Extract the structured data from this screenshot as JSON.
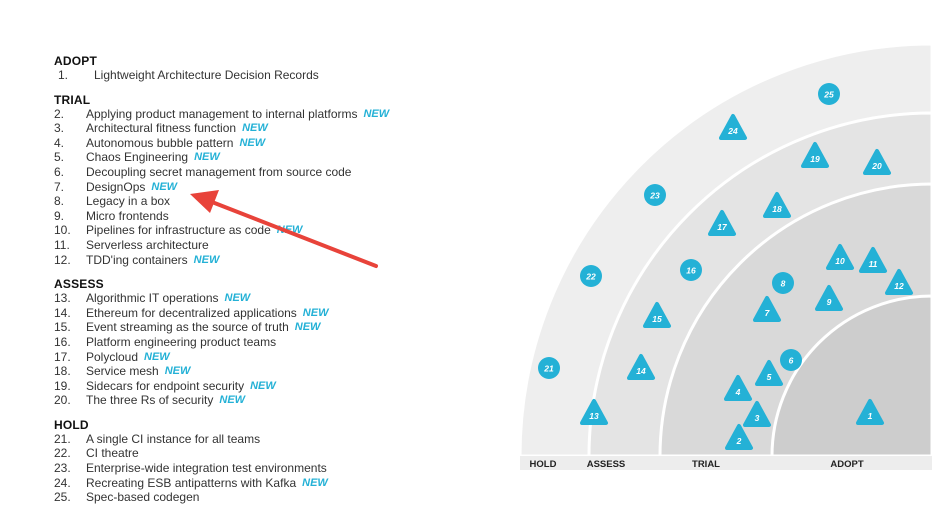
{
  "rings": [
    {
      "name": "ADOPT",
      "entries": [
        {
          "num": "1.",
          "label": "Lightweight Architecture Decision Records",
          "new": false
        }
      ]
    },
    {
      "name": "TRIAL",
      "entries": [
        {
          "num": "2.",
          "label": "Applying product management to internal platforms",
          "new": true
        },
        {
          "num": "3.",
          "label": "Architectural fitness function",
          "new": true
        },
        {
          "num": "4.",
          "label": "Autonomous bubble pattern",
          "new": true
        },
        {
          "num": "5.",
          "label": "Chaos Engineering",
          "new": true
        },
        {
          "num": "6.",
          "label": "Decoupling secret management from source code",
          "new": false
        },
        {
          "num": "7.",
          "label": "DesignOps",
          "new": true
        },
        {
          "num": "8.",
          "label": "Legacy in a box",
          "new": false
        },
        {
          "num": "9.",
          "label": "Micro frontends",
          "new": false
        },
        {
          "num": "10.",
          "label": "Pipelines for infrastructure as code",
          "new": true
        },
        {
          "num": "11.",
          "label": "Serverless architecture",
          "new": false
        },
        {
          "num": "12.",
          "label": "TDD'ing containers",
          "new": true
        }
      ]
    },
    {
      "name": "ASSESS",
      "entries": [
        {
          "num": "13.",
          "label": "Algorithmic IT operations",
          "new": true
        },
        {
          "num": "14.",
          "label": "Ethereum for decentralized applications",
          "new": true
        },
        {
          "num": "15.",
          "label": "Event streaming as the source of truth",
          "new": true
        },
        {
          "num": "16.",
          "label": "Platform engineering product teams",
          "new": false
        },
        {
          "num": "17.",
          "label": "Polycloud",
          "new": true
        },
        {
          "num": "18.",
          "label": "Service mesh",
          "new": true
        },
        {
          "num": "19.",
          "label": "Sidecars for endpoint security",
          "new": true
        },
        {
          "num": "20.",
          "label": "The three Rs of security",
          "new": true
        }
      ]
    },
    {
      "name": "HOLD",
      "entries": [
        {
          "num": "21.",
          "label": "A single CI instance for all teams",
          "new": false
        },
        {
          "num": "22.",
          "label": "CI theatre",
          "new": false
        },
        {
          "num": "23.",
          "label": "Enterprise-wide integration test environments",
          "new": false
        },
        {
          "num": "24.",
          "label": "Recreating ESB antipatterns with Kafka",
          "new": true
        },
        {
          "num": "25.",
          "label": "Spec-based codegen",
          "new": false
        }
      ]
    }
  ],
  "new_tag": "NEW",
  "radar": {
    "ring_labels": [
      "HOLD",
      "ASSESS",
      "TRIAL",
      "ADOPT"
    ],
    "colors": {
      "blip": "#24b1d6",
      "ring_hold": "#eeeeee",
      "ring_assess": "#e4e4e4",
      "ring_trial": "#d9d9d9",
      "ring_adopt": "#cdcdcd",
      "arrow": "#e8433a",
      "new_text": "#24b1d6"
    },
    "blips": [
      {
        "id": "1",
        "shape": "triangle"
      },
      {
        "id": "2",
        "shape": "triangle"
      },
      {
        "id": "3",
        "shape": "triangle"
      },
      {
        "id": "4",
        "shape": "triangle"
      },
      {
        "id": "5",
        "shape": "triangle"
      },
      {
        "id": "6",
        "shape": "circle"
      },
      {
        "id": "7",
        "shape": "triangle"
      },
      {
        "id": "8",
        "shape": "circle"
      },
      {
        "id": "9",
        "shape": "triangle"
      },
      {
        "id": "10",
        "shape": "triangle"
      },
      {
        "id": "11",
        "shape": "triangle"
      },
      {
        "id": "12",
        "shape": "triangle"
      },
      {
        "id": "13",
        "shape": "triangle"
      },
      {
        "id": "14",
        "shape": "triangle"
      },
      {
        "id": "15",
        "shape": "triangle"
      },
      {
        "id": "16",
        "shape": "circle"
      },
      {
        "id": "17",
        "shape": "triangle"
      },
      {
        "id": "18",
        "shape": "triangle"
      },
      {
        "id": "19",
        "shape": "triangle"
      },
      {
        "id": "20",
        "shape": "triangle"
      },
      {
        "id": "21",
        "shape": "circle"
      },
      {
        "id": "22",
        "shape": "circle"
      },
      {
        "id": "23",
        "shape": "circle"
      },
      {
        "id": "24",
        "shape": "triangle"
      },
      {
        "id": "25",
        "shape": "circle"
      }
    ]
  }
}
